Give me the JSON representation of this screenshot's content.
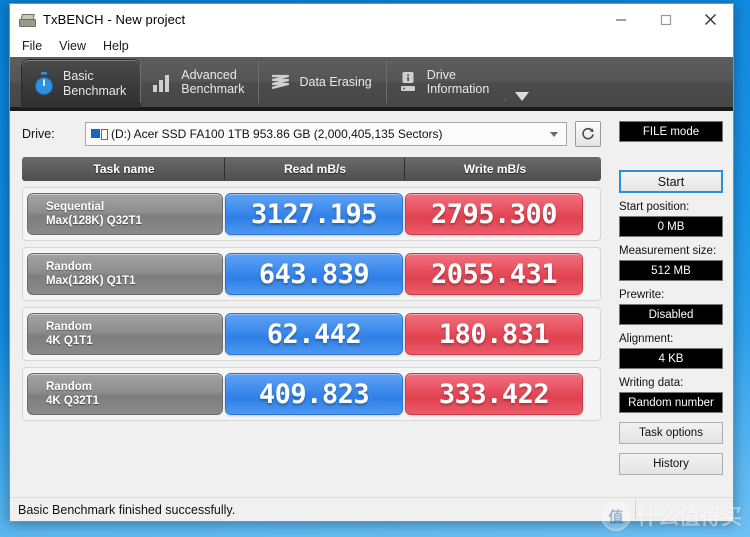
{
  "window": {
    "title": "TxBENCH - New project",
    "icon": "drive-app-icon",
    "controls": {
      "minimize": "—",
      "maximize": "□",
      "close": "✕"
    }
  },
  "menubar": {
    "items": [
      "File",
      "View",
      "Help"
    ]
  },
  "tabs": [
    {
      "id": "basic-benchmark",
      "line1": "Basic",
      "line2": "Benchmark",
      "icon": "stopwatch-icon",
      "active": true
    },
    {
      "id": "advanced-benchmark",
      "line1": "Advanced",
      "line2": "Benchmark",
      "icon": "bar-chart-icon",
      "active": false
    },
    {
      "id": "data-erasing",
      "line1": "Data Erasing",
      "line2": "",
      "icon": "shredder-icon",
      "active": false
    },
    {
      "id": "drive-information",
      "line1": "Drive",
      "line2": "Information",
      "icon": "drive-info-icon",
      "active": false
    }
  ],
  "tab_overflow_icon": "chevron-down-icon",
  "drive": {
    "label": "Drive:",
    "selected": "(D:) Acer SSD FA100 1TB  953.86 GB (2,000,405,135 Sectors)",
    "icon": "disk-icon",
    "dropdown_icon": "chevron-down-icon",
    "refresh_icon": "refresh-icon"
  },
  "results_table": {
    "headers": [
      "Task name",
      "Read mB/s",
      "Write mB/s"
    ],
    "rows": [
      {
        "task_line1": "Sequential",
        "task_line2": "Max(128K) Q32T1",
        "read": "3127.195",
        "write": "2795.300"
      },
      {
        "task_line1": "Random",
        "task_line2": "Max(128K) Q1T1",
        "read": "643.839",
        "write": "2055.431"
      },
      {
        "task_line1": "Random",
        "task_line2": "4K Q1T1",
        "read": "62.442",
        "write": "180.831"
      },
      {
        "task_line1": "Random",
        "task_line2": "4K Q32T1",
        "read": "409.823",
        "write": "333.422"
      }
    ]
  },
  "panel": {
    "mode": "FILE mode",
    "start_button": "Start",
    "start_position_label": "Start position:",
    "start_position_value": "0 MB",
    "measurement_size_label": "Measurement size:",
    "measurement_size_value": "512 MB",
    "prewrite_label": "Prewrite:",
    "prewrite_value": "Disabled",
    "alignment_label": "Alignment:",
    "alignment_value": "4 KB",
    "writing_data_label": "Writing data:",
    "writing_data_value": "Random number",
    "task_options_button": "Task options",
    "history_button": "History"
  },
  "statusbar": {
    "message": "Basic Benchmark finished successfully."
  },
  "watermark": {
    "logo_char": "值",
    "text": "什么值得买"
  },
  "colors": {
    "read_accent": "#3f8ced",
    "write_accent": "#e8505f",
    "window_accent": "#2b8fd6",
    "tabstrip": "#4f4f4f",
    "panel_value_bg": "#000000"
  }
}
